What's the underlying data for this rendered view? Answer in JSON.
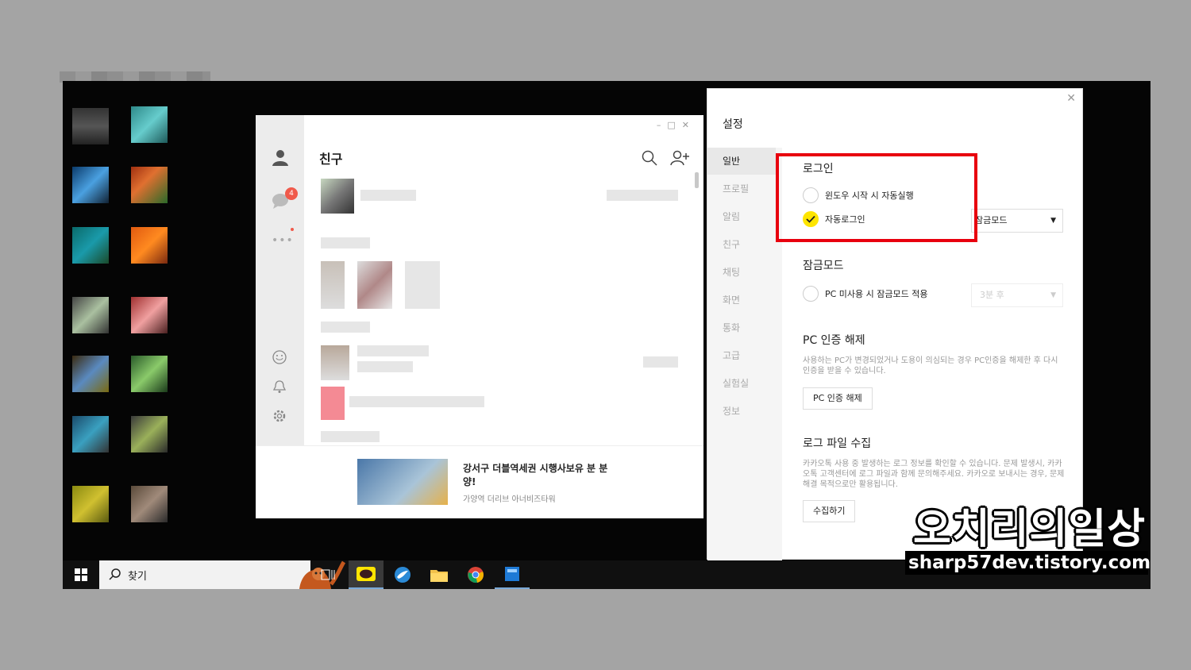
{
  "taskbar": {
    "search_label": "찾기"
  },
  "kakao": {
    "title": "친구",
    "badge_count": "4",
    "ad": {
      "title": "강서구 더블역세권 시행사보유 분 분양!",
      "subtitle": "가양역 더리브 아너비즈타워"
    }
  },
  "settings": {
    "title": "설정",
    "nav": [
      "일반",
      "프로필",
      "알림",
      "친구",
      "채팅",
      "화면",
      "통화",
      "고급",
      "실험실",
      "정보"
    ],
    "login": {
      "title": "로그인",
      "auto_start": "윈도우 시작 시 자동실행",
      "auto_login": "자동로그인",
      "lock_dropdown": "잠금모드"
    },
    "lock": {
      "title": "잠금모드",
      "option": "PC 미사용 시 잠금모드 적용",
      "dropdown": "3분 후"
    },
    "pc_auth": {
      "title": "PC 인증 해제",
      "desc": "사용하는 PC가 변경되었거나 도용이 의심되는 경우 PC인증을 해제한 후 다시 인증을 받을 수 있습니다.",
      "button": "PC 인증 해제"
    },
    "log": {
      "title": "로그 파일 수집",
      "desc": "카카오톡 사용 중 발생하는 로그 정보를 확인할 수 있습니다. 문제 발생시, 카카오톡 고객센터에 로그 파일과 함께 문의해주세요. 카카오로 보내시는 경우, 문제 해결 목적으로만 활용됩니다.",
      "button": "수집하기"
    }
  },
  "watermark": {
    "main": "오치리의일상",
    "url": "sharp57dev.tistory.com"
  },
  "colors": {
    "kakao_yellow": "#fee500",
    "highlight_red": "#e8000e",
    "badge_red": "#f05a4b"
  }
}
